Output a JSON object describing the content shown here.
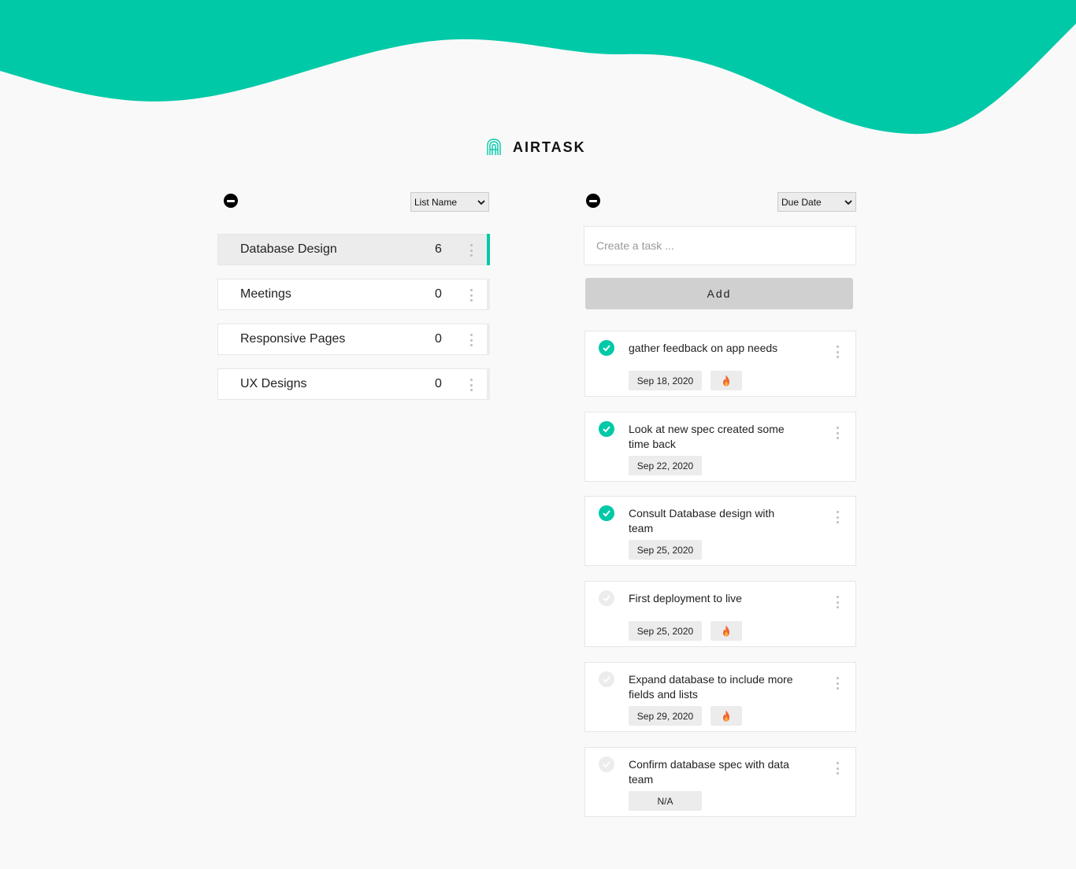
{
  "brand": {
    "name": "AIRTASK",
    "logo_icon": "airtask-logo-icon"
  },
  "colors": {
    "accent": "#00c9a7",
    "pill": "#ececec",
    "background": "#f9f9f9"
  },
  "lists_panel": {
    "sort_label": "List Name",
    "items": [
      {
        "name": "Database Design",
        "count": "6",
        "active": true
      },
      {
        "name": "Meetings",
        "count": "0",
        "active": false
      },
      {
        "name": "Responsive Pages",
        "count": "0",
        "active": false
      },
      {
        "name": "UX Designs",
        "count": "0",
        "active": false
      }
    ]
  },
  "tasks_panel": {
    "sort_label": "Due Date",
    "input_placeholder": "Create a task ...",
    "add_label": "Add",
    "tasks": [
      {
        "text": "gather feedback on app needs",
        "date": "Sep 18, 2020",
        "done": true,
        "priority": true
      },
      {
        "text": "Look at new spec created some time back",
        "date": "Sep 22, 2020",
        "done": true,
        "priority": false
      },
      {
        "text": "Consult Database design with team",
        "date": "Sep 25, 2020",
        "done": true,
        "priority": false
      },
      {
        "text": "First deployment to live",
        "date": "Sep 25, 2020",
        "done": false,
        "priority": true
      },
      {
        "text": "Expand database to include more fields and lists",
        "date": "Sep 29, 2020",
        "done": false,
        "priority": true
      },
      {
        "text": "Confirm database spec with data team",
        "date": "N/A",
        "done": false,
        "priority": false
      }
    ]
  }
}
